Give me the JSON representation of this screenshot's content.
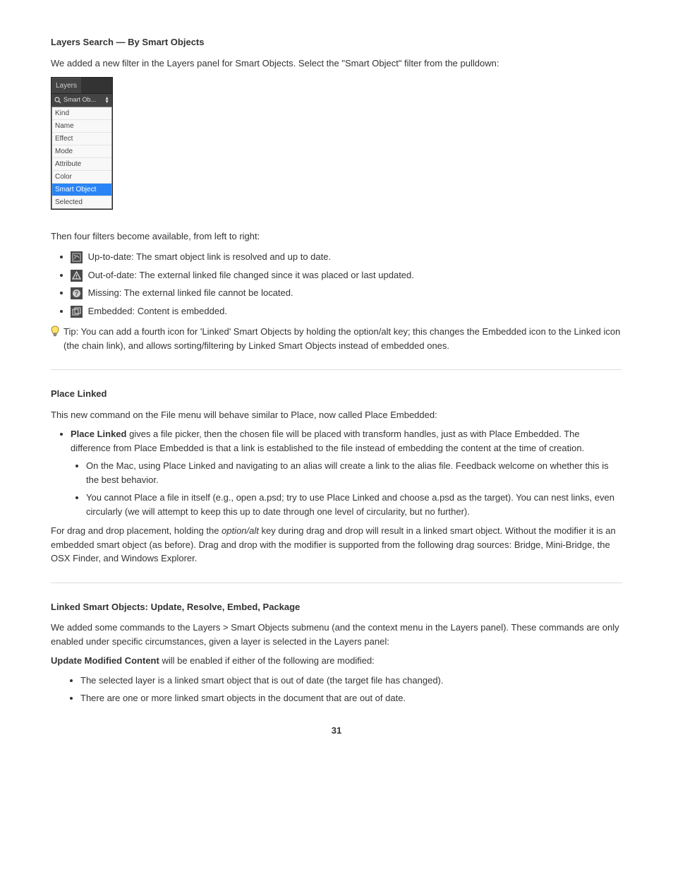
{
  "section1": {
    "title": "Layers Search — By Smart Objects",
    "intro": "We added a new filter in the Layers panel for Smart Objects. Select the \"Smart Object\" filter from the pulldown:",
    "panel_tab": "Layers",
    "search_label": "Smart Ob...",
    "dropdown": [
      "Kind",
      "Name",
      "Effect",
      "Mode",
      "Attribute",
      "Color",
      "Smart Object",
      "Selected"
    ],
    "filter_intro": "Then four filters become available, from left to right:",
    "filters": [
      {
        "label": "Up-to-date: The smart object link is resolved and up to date."
      },
      {
        "label": "Out-of-date: The external linked file changed since it was placed or last updated."
      },
      {
        "label": "Missing: The external linked file cannot be located."
      },
      {
        "label": "Embedded: Content is embedded."
      }
    ],
    "tip": "Tip: You can add a fourth icon for 'Linked' Smart Objects by holding the option/alt key; this changes the Embedded icon to the Linked icon (the chain link), and allows sorting/filtering by Linked Smart Objects instead of embedded ones."
  },
  "section2": {
    "title": "Place Linked",
    "p1": "This new command on the File menu will behave similar to Place, now called Place Embedded:",
    "b1_lead": "Place Linked",
    "b1_rest": " gives a file picker, then the chosen file will be placed with transform handles, just as with Place Embedded. The difference from Place Embedded is that a link is established to the file instead of embedding the content at the time of creation.",
    "sub1": "On the Mac, using Place Linked and navigating to an alias will create a link to the alias file. Feedback welcome on whether this is the best behavior.",
    "sub2": "You cannot Place a file in itself (e.g., open a.psd; try to use Place Linked and choose a.psd as the target). You can nest links, even circularly (we will attempt to keep this up to date through one level of circularity, but no further).",
    "p2_pre": "For drag and drop placement, holding the ",
    "p2_key": "option/alt",
    "p2_post": " key during drag and drop will result in a linked smart object. Without the modifier it is an embedded smart object (as before). Drag and drop with the modifier is supported from the following drag sources: Bridge, Mini-Bridge, the OSX Finder, and Windows Explorer."
  },
  "section3": {
    "title": "Linked Smart Objects: Update, Resolve, Embed, Package",
    "p1": "We added some commands to the Layers > Smart Objects submenu (and the context menu in the Layers panel). These commands are only enabled under specific circumstances, given a layer is selected in the Layers panel:",
    "p2_lead": "Update Modified Content",
    "p2_rest": " will be enabled if either of the following are modified:",
    "li1": "The selected layer is a linked smart object that is out of date (the target file has changed).",
    "li2": "There are one or more linked smart objects in the document that are out of date."
  },
  "page_number": "31"
}
